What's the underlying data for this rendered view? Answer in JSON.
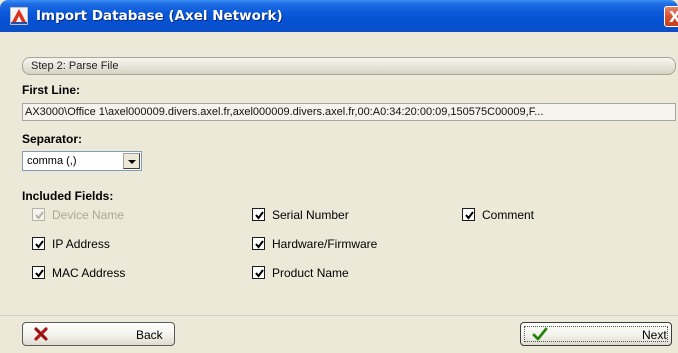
{
  "window": {
    "title": "Import Database (Axel Network)",
    "close_glyph": "X"
  },
  "step": {
    "label": "Step 2: Parse File"
  },
  "first_line": {
    "label": "First Line:",
    "value": "AX3000\\Office 1\\axel000009.divers.axel.fr,axel000009.divers.axel.fr,00:A0:34:20:00:09,150575C00009,F..."
  },
  "separator": {
    "label": "Separator:",
    "selected": "comma (,)"
  },
  "fields": {
    "label": "Included Fields:",
    "items": [
      {
        "label": "Device Name",
        "checked": true,
        "enabled": false
      },
      {
        "label": "IP Address",
        "checked": true,
        "enabled": true
      },
      {
        "label": "MAC Address",
        "checked": true,
        "enabled": true
      },
      {
        "label": "Serial Number",
        "checked": true,
        "enabled": true
      },
      {
        "label": "Hardware/Firmware",
        "checked": true,
        "enabled": true
      },
      {
        "label": "Product Name",
        "checked": true,
        "enabled": true
      },
      {
        "label": "Comment",
        "checked": true,
        "enabled": true
      }
    ]
  },
  "buttons": {
    "back": "Back",
    "next": "Next"
  },
  "icons": {
    "app": "axel-app-icon",
    "back": "red-x-icon",
    "next": "green-check-icon"
  },
  "colors": {
    "titlebar": "#0a58d8",
    "back_icon": "#b01818",
    "next_icon": "#3aa01e",
    "disabled_text": "#aca899"
  }
}
